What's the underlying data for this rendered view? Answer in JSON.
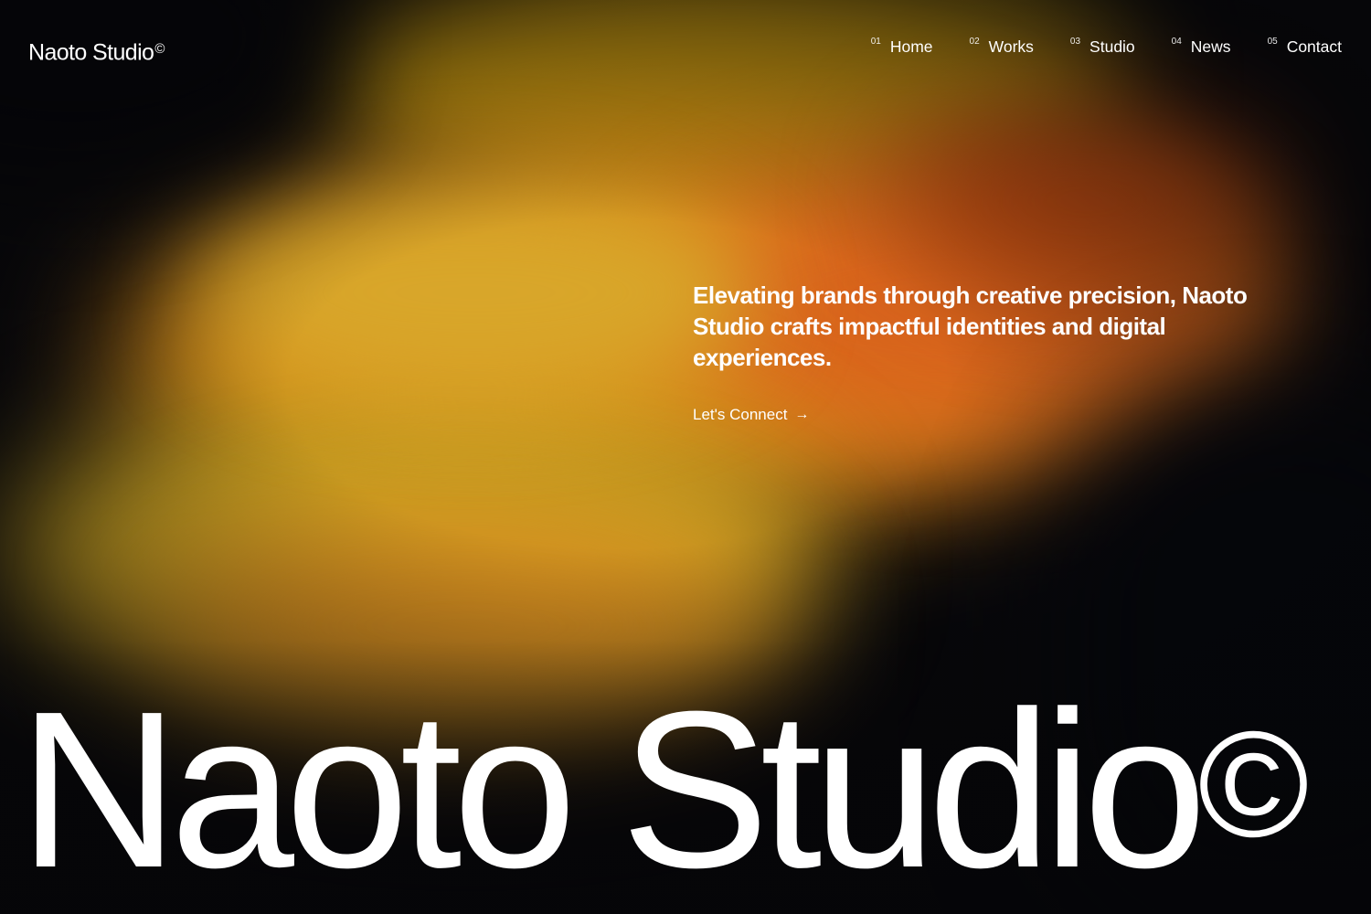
{
  "brand": {
    "name": "Naoto Studio",
    "mark": "©"
  },
  "nav": [
    {
      "num": "01",
      "label": "Home"
    },
    {
      "num": "02",
      "label": "Works"
    },
    {
      "num": "03",
      "label": "Studio"
    },
    {
      "num": "04",
      "label": "News"
    },
    {
      "num": "05",
      "label": "Contact"
    }
  ],
  "hero": {
    "text": "Elevating brands through creative precision, Naoto Studio crafts impactful identities and digital experiences.",
    "cta_label": "Let's Connect",
    "cta_icon": "arrow-right-icon"
  },
  "big_title": {
    "text": "Naoto Studio",
    "mark": "©"
  },
  "colors": {
    "text": "#ffffff",
    "background": "#060608",
    "glow_orange": "#d98a17",
    "glow_yellow": "#c9a322",
    "glow_red": "#d9651d"
  }
}
